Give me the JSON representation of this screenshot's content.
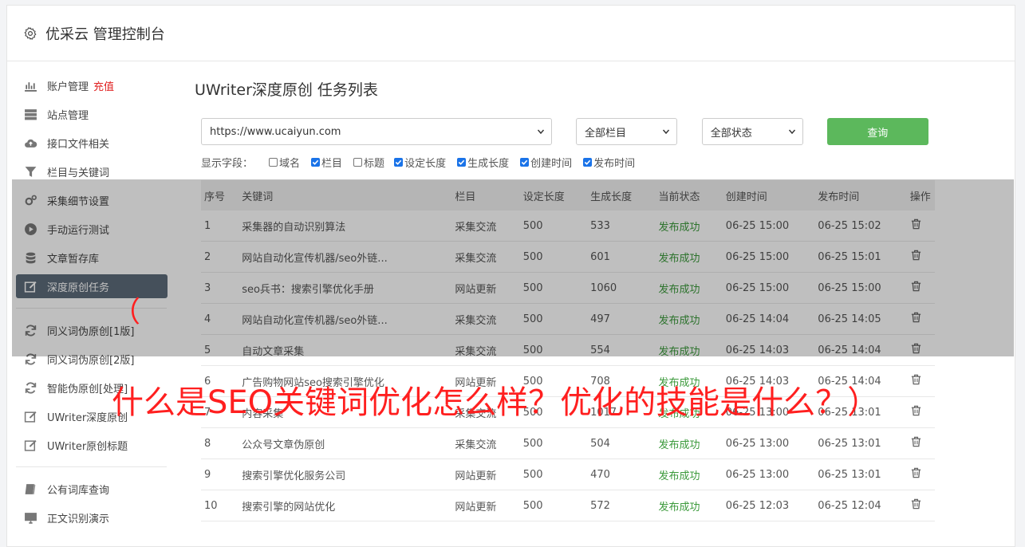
{
  "header": {
    "title": "优采云 管理控制台"
  },
  "sidebar": {
    "group1": [
      {
        "label": "账户管理",
        "extra": "充值",
        "icon": "bar-chart-icon"
      },
      {
        "label": "站点管理",
        "icon": "server-icon"
      },
      {
        "label": "接口文件相关",
        "icon": "cloud-upload-icon"
      },
      {
        "label": "栏目与关键词",
        "icon": "filter-icon"
      },
      {
        "label": "采集细节设置",
        "icon": "gears-icon"
      },
      {
        "label": "手动运行测试",
        "icon": "play-icon"
      },
      {
        "label": "文章暂存库",
        "icon": "database-icon"
      },
      {
        "label": "深度原创任务",
        "icon": "edit-icon",
        "active": true
      }
    ],
    "group2": [
      {
        "label": "同义词伪原创[1版]",
        "icon": "refresh-icon"
      },
      {
        "label": "同义词伪原创[2版]",
        "icon": "refresh-icon"
      },
      {
        "label": "智能伪原创[处理]",
        "icon": "refresh-icon"
      },
      {
        "label": "UWriter深度原创",
        "icon": "edit-icon"
      },
      {
        "label": "UWriter原创标题",
        "icon": "edit-icon"
      }
    ],
    "group3": [
      {
        "label": "公有词库查询",
        "icon": "book-icon"
      },
      {
        "label": "正文识别演示",
        "icon": "monitor-icon"
      }
    ]
  },
  "main": {
    "title": "UWriter深度原创 任务列表",
    "site_select": "https://www.ucaiyun.com",
    "column_select": "全部栏目",
    "status_select": "全部状态",
    "query_button": "查询",
    "fields_label": "显示字段：",
    "fields": [
      {
        "label": "域名",
        "checked": false
      },
      {
        "label": "栏目",
        "checked": true
      },
      {
        "label": "标题",
        "checked": false
      },
      {
        "label": "设定长度",
        "checked": true
      },
      {
        "label": "生成长度",
        "checked": true
      },
      {
        "label": "创建时间",
        "checked": true
      },
      {
        "label": "发布时间",
        "checked": true
      }
    ],
    "columns": [
      "序号",
      "关键词",
      "栏目",
      "设定长度",
      "生成长度",
      "当前状态",
      "创建时间",
      "发布时间",
      "操作"
    ],
    "rows": [
      [
        "1",
        "采集器的自动识别算法",
        "采集交流",
        "500",
        "533",
        "发布成功",
        "06-25 15:00",
        "06-25 15:02"
      ],
      [
        "2",
        "网站自动化宣传机器/seo外链...",
        "采集交流",
        "500",
        "601",
        "发布成功",
        "06-25 15:00",
        "06-25 15:01"
      ],
      [
        "3",
        "seo兵书：搜索引擎优化手册",
        "网站更新",
        "500",
        "1060",
        "发布成功",
        "06-25 15:00",
        "06-25 15:00"
      ],
      [
        "4",
        "网站自动化宣传机器/seo外链...",
        "采集交流",
        "500",
        "497",
        "发布成功",
        "06-25 14:04",
        "06-25 14:05"
      ],
      [
        "5",
        "自动文章采集",
        "采集交流",
        "500",
        "554",
        "发布成功",
        "06-25 14:03",
        "06-25 14:04"
      ],
      [
        "6",
        "广告购物网站seo搜索引擎优化",
        "网站更新",
        "500",
        "708",
        "发布成功",
        "06-25 14:03",
        "06-25 14:04"
      ],
      [
        "7",
        "内容采集",
        "采集交流",
        "500",
        "1017",
        "发布成功",
        "06-25 13:00",
        "06-25 13:01"
      ],
      [
        "8",
        "公众号文章伪原创",
        "采集交流",
        "500",
        "504",
        "发布成功",
        "06-25 13:00",
        "06-25 13:01"
      ],
      [
        "9",
        "搜索引擎优化服务公司",
        "网站更新",
        "500",
        "470",
        "发布成功",
        "06-25 13:00",
        "06-25 13:01"
      ],
      [
        "10",
        "搜索引擎的网站优化",
        "网站更新",
        "500",
        "572",
        "发布成功",
        "06-25 12:03",
        "06-25 12:04"
      ]
    ]
  },
  "overlay": {
    "paren": "（",
    "caption": "什么是SEO关键词优化怎么样？优化的技能是什么？）"
  },
  "colors": {
    "accent_green": "#5cb85c",
    "active_nav": "#5d6b7a",
    "status_ok": "#3c9a3c",
    "caption_red": "#ff1f1f"
  }
}
